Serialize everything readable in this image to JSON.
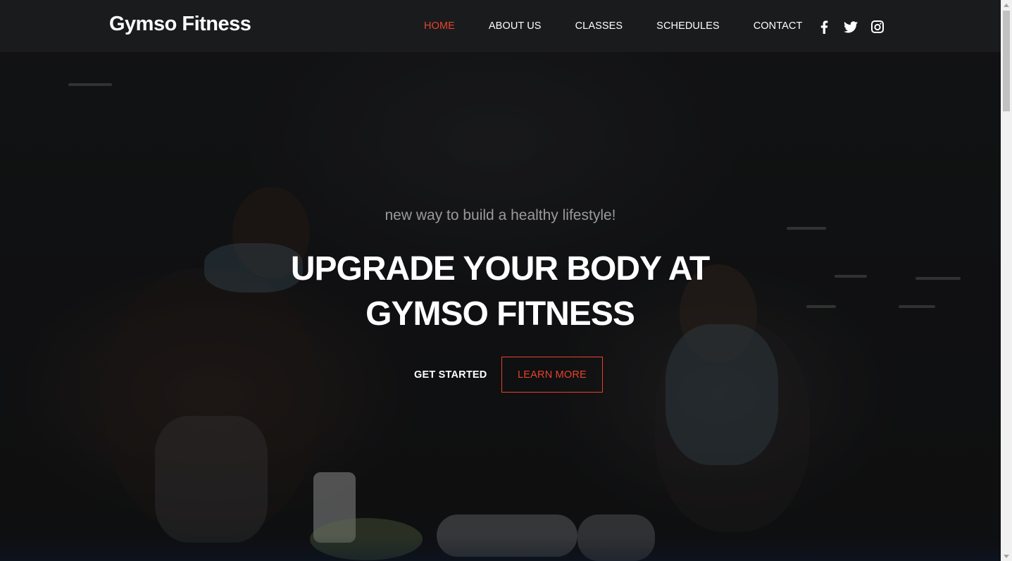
{
  "brand": {
    "name": "Gymso Fitness"
  },
  "nav": {
    "items": [
      {
        "label": "HOME",
        "active": true
      },
      {
        "label": "ABOUT US",
        "active": false
      },
      {
        "label": "CLASSES",
        "active": false
      },
      {
        "label": "SCHEDULES",
        "active": false
      },
      {
        "label": "CONTACT",
        "active": false
      }
    ]
  },
  "social": {
    "icons": [
      "facebook-icon",
      "twitter-icon",
      "instagram-icon"
    ]
  },
  "hero": {
    "tagline": "new way to build a healthy lifestyle!",
    "headline_line1": "UPGRADE YOUR BODY AT",
    "headline_line2": "GYMSO FITNESS",
    "primary_cta": "GET STARTED",
    "secondary_cta": "LEARN MORE"
  },
  "colors": {
    "accent": "#e8432a",
    "background": "#1a1b1d",
    "text": "#ffffff",
    "muted": "#9a9a9a"
  }
}
